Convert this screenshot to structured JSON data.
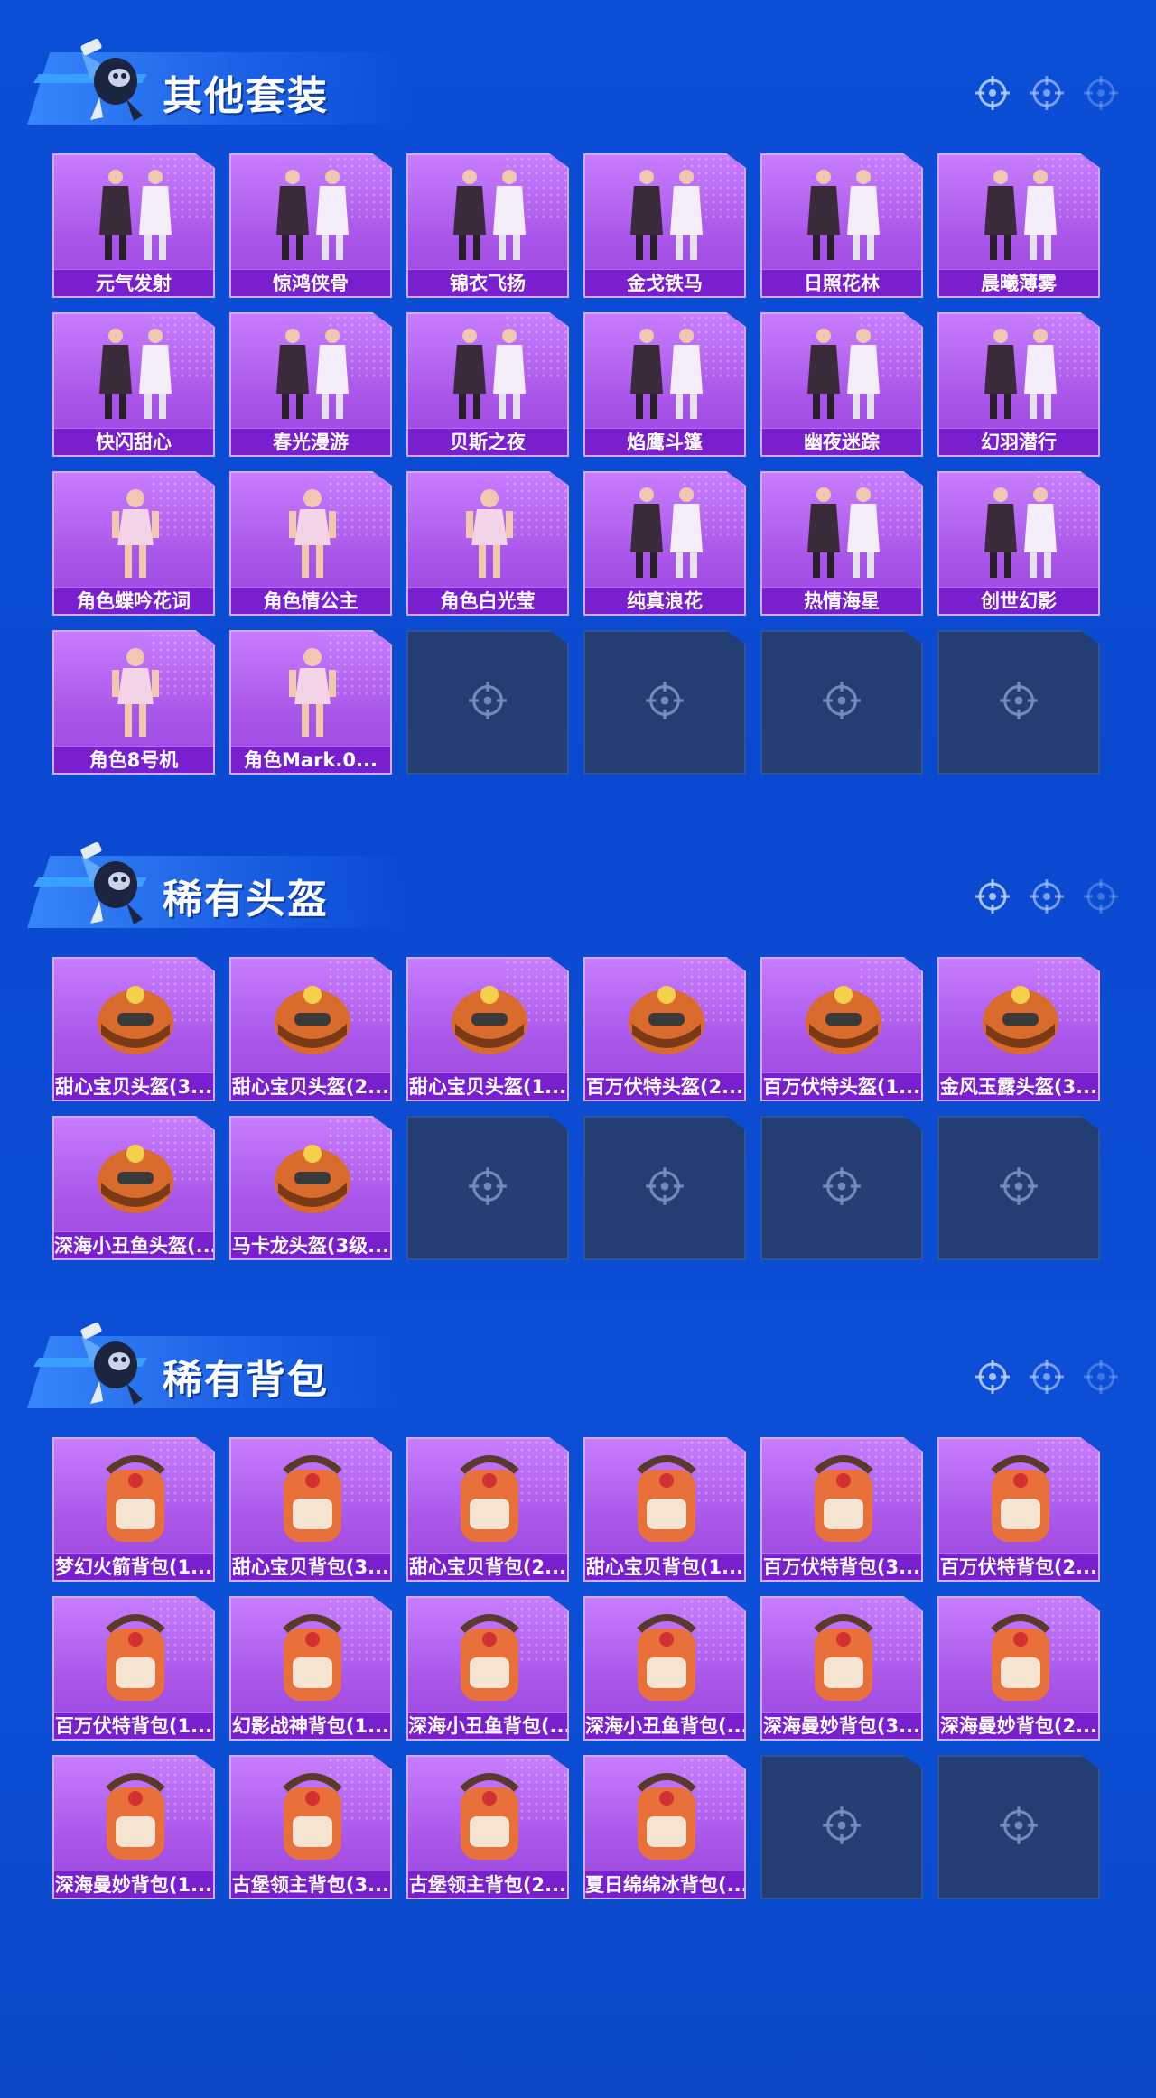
{
  "colors": {
    "background": "#0b4fd6",
    "card": "#b86af2",
    "card_label_bg": "#7a1fd0",
    "empty_slot": "#233e73",
    "title_text": "#ffffff"
  },
  "sections": [
    {
      "title": "其他套装",
      "items": [
        {
          "label": "元气发射",
          "icon": "outfit-icon"
        },
        {
          "label": "惊鸿侠骨",
          "icon": "outfit-icon"
        },
        {
          "label": "锦衣飞扬",
          "icon": "outfit-icon"
        },
        {
          "label": "金戈铁马",
          "icon": "outfit-icon"
        },
        {
          "label": "日照花林",
          "icon": "outfit-icon"
        },
        {
          "label": "晨曦薄雾",
          "icon": "outfit-icon"
        },
        {
          "label": "快闪甜心",
          "icon": "outfit-icon"
        },
        {
          "label": "春光漫游",
          "icon": "outfit-icon"
        },
        {
          "label": "贝斯之夜",
          "icon": "outfit-icon"
        },
        {
          "label": "焰鹰斗篷",
          "icon": "outfit-icon"
        },
        {
          "label": "幽夜迷踪",
          "icon": "outfit-icon"
        },
        {
          "label": "幻羽潜行",
          "icon": "outfit-icon"
        },
        {
          "label": "角色蝶吟花词",
          "icon": "character-icon"
        },
        {
          "label": "角色情公主",
          "icon": "character-icon"
        },
        {
          "label": "角色白光莹",
          "icon": "character-icon"
        },
        {
          "label": "纯真浪花",
          "icon": "outfit-icon"
        },
        {
          "label": "热情海星",
          "icon": "outfit-icon"
        },
        {
          "label": "创世幻影",
          "icon": "outfit-icon"
        },
        {
          "label": "角色8号机",
          "icon": "character-icon"
        },
        {
          "label": "角色Mark.0...",
          "icon": "character-icon"
        }
      ],
      "empty_slots": 4
    },
    {
      "title": "稀有头盔",
      "items": [
        {
          "label": "甜心宝贝头盔(3...",
          "icon": "helmet-icon"
        },
        {
          "label": "甜心宝贝头盔(2...",
          "icon": "helmet-icon"
        },
        {
          "label": "甜心宝贝头盔(1...",
          "icon": "helmet-icon"
        },
        {
          "label": "百万伏特头盔(2...",
          "icon": "helmet-icon"
        },
        {
          "label": "百万伏特头盔(1...",
          "icon": "helmet-icon"
        },
        {
          "label": "金风玉露头盔(3...",
          "icon": "helmet-icon"
        },
        {
          "label": "深海小丑鱼头盔(...",
          "icon": "helmet-icon"
        },
        {
          "label": "马卡龙头盔(3级...",
          "icon": "helmet-icon"
        }
      ],
      "empty_slots": 4
    },
    {
      "title": "稀有背包",
      "items": [
        {
          "label": "梦幻火箭背包(1...",
          "icon": "backpack-icon"
        },
        {
          "label": "甜心宝贝背包(3...",
          "icon": "backpack-icon"
        },
        {
          "label": "甜心宝贝背包(2...",
          "icon": "backpack-icon"
        },
        {
          "label": "甜心宝贝背包(1...",
          "icon": "backpack-icon"
        },
        {
          "label": "百万伏特背包(3...",
          "icon": "backpack-icon"
        },
        {
          "label": "百万伏特背包(2...",
          "icon": "backpack-icon"
        },
        {
          "label": "百万伏特背包(1...",
          "icon": "backpack-icon"
        },
        {
          "label": "幻影战神背包(1...",
          "icon": "backpack-icon"
        },
        {
          "label": "深海小丑鱼背包(...",
          "icon": "backpack-icon"
        },
        {
          "label": "深海小丑鱼背包(...",
          "icon": "backpack-icon"
        },
        {
          "label": "深海曼妙背包(3...",
          "icon": "backpack-icon"
        },
        {
          "label": "深海曼妙背包(2...",
          "icon": "backpack-icon"
        },
        {
          "label": "深海曼妙背包(1...",
          "icon": "backpack-icon"
        },
        {
          "label": "古堡领主背包(3...",
          "icon": "backpack-icon"
        },
        {
          "label": "古堡领主背包(2...",
          "icon": "backpack-icon"
        },
        {
          "label": "夏日绵绵冰背包(...",
          "icon": "backpack-icon"
        }
      ],
      "empty_slots": 2
    }
  ]
}
